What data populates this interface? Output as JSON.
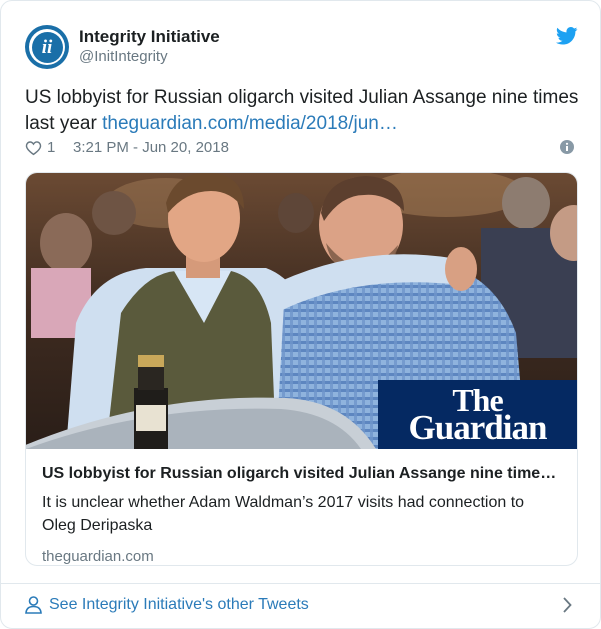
{
  "account": {
    "name": "Integrity Initiative",
    "handle": "@InitIntegrity",
    "avatar_glyph": "ii"
  },
  "tweet": {
    "text": "US lobbyist for Russian oligarch visited Julian Assange nine times last year ",
    "link_text": "theguardian.com/media/2018/jun…",
    "likes": "1",
    "timestamp": "3:21 PM - Jun 20, 2018"
  },
  "card": {
    "logo_line1": "The",
    "logo_line2": "Guardian",
    "title": "US lobbyist for Russian oligarch visited Julian Assange nine time…",
    "description": "It is unclear whether Adam Waldman’s 2017 visits had connection to Oleg Deripaska",
    "domain": "theguardian.com"
  },
  "footer": {
    "link_text": "See Integrity Initiative's other Tweets"
  },
  "colors": {
    "link": "#2b7bb9",
    "twitter_blue": "#1da1f2",
    "muted": "#697882",
    "guardian_navy": "#052962",
    "avatar_blue": "#1a6fa8"
  },
  "icons": [
    "twitter-bird-icon",
    "heart-icon",
    "info-icon",
    "person-icon",
    "chevron-right-icon"
  ]
}
